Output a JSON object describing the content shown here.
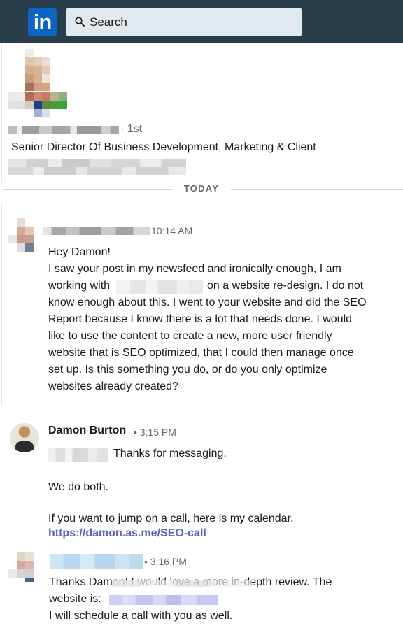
{
  "header": {
    "logo_text": "in",
    "search_placeholder": "Search"
  },
  "profile": {
    "degree": "· 1st",
    "headline": "Senior Director Of Business Development, Marketing & Client"
  },
  "divider": {
    "label": "TODAY"
  },
  "messages": [
    {
      "time": "10:14 AM",
      "lines": [
        "Hey Damon!",
        "I saw your post in my newsfeed and ironically enough, I am",
        "working with",
        "on a website re-design. I do not",
        "know enough about this. I went to your website and did the SEO",
        "Report because I know there is a lot that needs done. I would",
        "like to use the content to create a new, more user friendly",
        "website that is SEO optimized, that I could then manage once",
        "set up. Is this something you do, or do you only optimize",
        "websites already created?"
      ]
    },
    {
      "sender": "Damon Burton",
      "time": "• 3:15 PM",
      "lines": [
        "Thanks for messaging.",
        "We do both.",
        "If you want to jump on a call, here is my calendar."
      ],
      "link": "https://damon.as.me/SEO-call"
    },
    {
      "time": "• 3:16 PM",
      "lines": [
        "Thanks Damon! I would love a more in-depth review. The",
        "website is:",
        "I will schedule a call with you as well."
      ]
    }
  ],
  "colors": {
    "topbar": "#283e4a",
    "brand": "#0a66c2",
    "link": "#5b5fc7"
  }
}
